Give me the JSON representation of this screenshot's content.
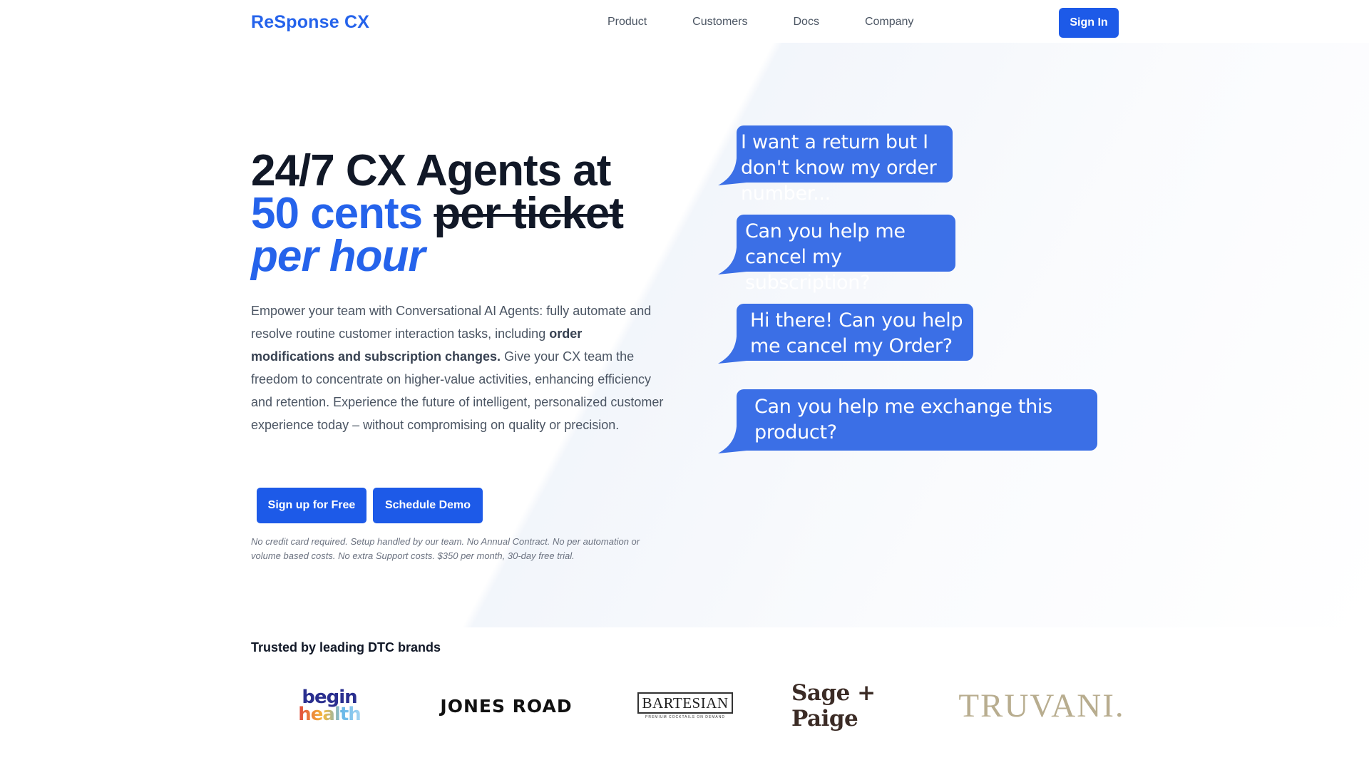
{
  "nav": {
    "brand": "ReSponse CX",
    "links": [
      "Product",
      "Customers",
      "Docs",
      "Company"
    ],
    "signin_label": "Sign In"
  },
  "hero": {
    "headline_line1": "24/7 CX Agents at",
    "headline_price": "50 cents",
    "headline_struck": "per ticket",
    "headline_line3": "per hour",
    "para_part1": "Empower your team with Conversational AI Agents: fully automate and resolve routine customer interaction tasks, including ",
    "para_bold": "order modifications and subscription changes.",
    "para_part2": " Give your CX team the freedom to concentrate on higher-value activities, enhancing efficiency and retention. Experience the future of intelligent, personalized customer experience today – without compromising on quality or precision.",
    "signup_label": "Sign up for Free",
    "demo_label": "Schedule Demo",
    "fineprint": "No credit card required. Setup handled by our team. No Annual Contract. No per automation or volume based costs. No extra Support costs. $350 per month, 30-day free trial."
  },
  "chat_bubbles": [
    "I want a return but I don't know my order number...",
    "Can you help me cancel my subscription?",
    "Hi there! Can you help me cancel my Order?",
    "Can you help me exchange this product?"
  ],
  "trusted": {
    "heading": "Trusted by leading DTC brands",
    "logos": {
      "begin_line1": "begin",
      "begin_line2": "health",
      "jones": "JONES ROAD",
      "bartesian": "BARTESIAN",
      "bartesian_sub": "PREMIUM COCKTAILS ON DEMAND",
      "sage": "Sage + Paige",
      "truvani": "TRUVANI."
    }
  },
  "colors": {
    "brand_blue": "#2563eb",
    "button_blue": "#1d5ae8",
    "bubble_blue": "#3b6fe6"
  }
}
